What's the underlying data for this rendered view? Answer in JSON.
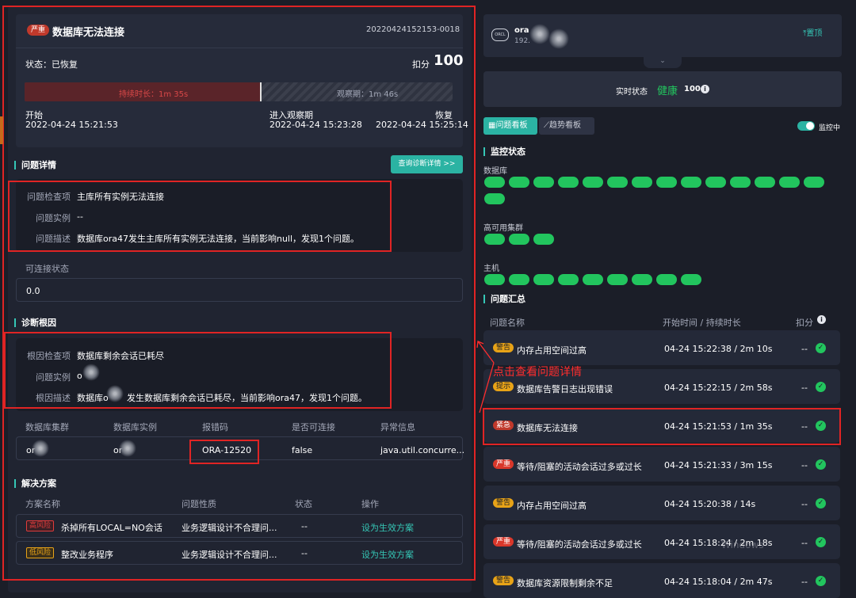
{
  "left": {
    "level_badge": "严重",
    "title": "数据库无法连接",
    "incident_id": "20220424152153-0018",
    "status_label": "状态：已恢复",
    "score_label": "扣分",
    "score_value": "100",
    "duration_label": "持续时长：1m 35s",
    "observe_label": "观察期：1m 46s",
    "duration_fraction": 0.55,
    "timeline": {
      "start_label": "开始",
      "start_time": "2022-04-24 15:21:53",
      "observe_label": "进入观察期",
      "observe_time": "2022-04-24 15:23:28",
      "recover_label": "恢复",
      "recover_time": "2022-04-24 15:25:14"
    },
    "problem_section": "问题详情",
    "diag_button": "查询诊断详情 >>",
    "problem": {
      "check_label": "问题检查项",
      "check_value": "主库所有实例无法连接",
      "instance_label": "问题实例",
      "instance_value": "--",
      "desc_label": "问题描述",
      "desc_value": "数据库ora47发生主库所有实例无法连接，当前影响null，发现1个问题。"
    },
    "connect_label": "可连接状态",
    "connect_value": "0.0",
    "root_section": "诊断根因",
    "root": {
      "check_label": "根因检查项",
      "check_value": "数据库剩余会话已耗尽",
      "instance_label": "问题实例",
      "instance_value": "o",
      "desc_label": "根因描述",
      "desc_prefix": "数据库o",
      "desc_value": "发生数据库剩余会话已耗尽，当前影响ora47，发现1个问题。"
    },
    "table": {
      "headers": [
        "数据库集群",
        "数据库实例",
        "报错码",
        "是否可连接",
        "异常信息"
      ],
      "row": [
        "or",
        "or",
        "ORA-12520",
        "false",
        "java.util.concurre..."
      ]
    },
    "solution_section": "解决方案",
    "solutions": {
      "headers": [
        "方案名称",
        "问题性质",
        "状态",
        "操作"
      ],
      "rows": [
        {
          "risk": "高风险",
          "name": "杀掉所有LOCAL=NO会话",
          "nature": "业务逻辑设计不合理问...",
          "status": "--",
          "action": "设为生效方案"
        },
        {
          "risk": "低风险",
          "name": "整改业务程序",
          "nature": "业务逻辑设计不合理问...",
          "status": "--",
          "action": "设为生效方案"
        }
      ]
    }
  },
  "right": {
    "db_logo": "ORCL",
    "db_name": "ora",
    "db_ip": "192.",
    "pin_label": "置顶",
    "realtime_label": "实时状态",
    "health_label": "健康",
    "health_score": "100",
    "tabs": [
      "问题看板",
      "趋势看板"
    ],
    "monitor_label": "监控中",
    "monitor_section": "监控状态",
    "groups": [
      {
        "label": "数据库",
        "count": 15
      },
      {
        "label": "高可用集群",
        "count": 3
      },
      {
        "label": "主机",
        "count": 9
      }
    ],
    "summary_section": "问题汇总",
    "summary_headers": [
      "问题名称",
      "开始时间 / 持续时长",
      "扣分"
    ],
    "annotation": "点击查看问题详情",
    "problems": [
      {
        "badge": "警告",
        "name": "内存占用空间过高",
        "time": "04-24 15:22:38 / 2m 10s",
        "score": "--"
      },
      {
        "badge": "提示",
        "name": "数据库告警日志出现错误",
        "time": "04-24 15:22:15 / 2m 58s",
        "score": "--"
      },
      {
        "badge": "紧急",
        "name": "数据库无法连接",
        "time": "04-24 15:21:53 / 1m 35s",
        "score": "--"
      },
      {
        "badge": "严重",
        "name": "等待/阻塞的活动会话过多或过长",
        "time": "04-24 15:21:33 / 3m 15s",
        "score": "--"
      },
      {
        "badge": "警告",
        "name": "内存占用空间过高",
        "time": "04-24 15:20:38 / 14s",
        "score": "--"
      },
      {
        "badge": "严重",
        "name": "等待/阻塞的活动会话过多或过长",
        "time": "04-24 15:18:24 / 2m 18s",
        "score": "--"
      },
      {
        "badge": "警告",
        "name": "数据库资源限制剩余不足",
        "time": "04-24 15:18:04 / 2m 47s",
        "score": "--"
      }
    ],
    "watermark": "Windows"
  },
  "colors": {
    "critical": "#c0392b",
    "severe": "#d9372a",
    "warning": "#e8a317",
    "info": "#e8a317",
    "healthy": "#22c55e",
    "teal": "#35c7b6",
    "annotation": "#ff2d2d"
  }
}
